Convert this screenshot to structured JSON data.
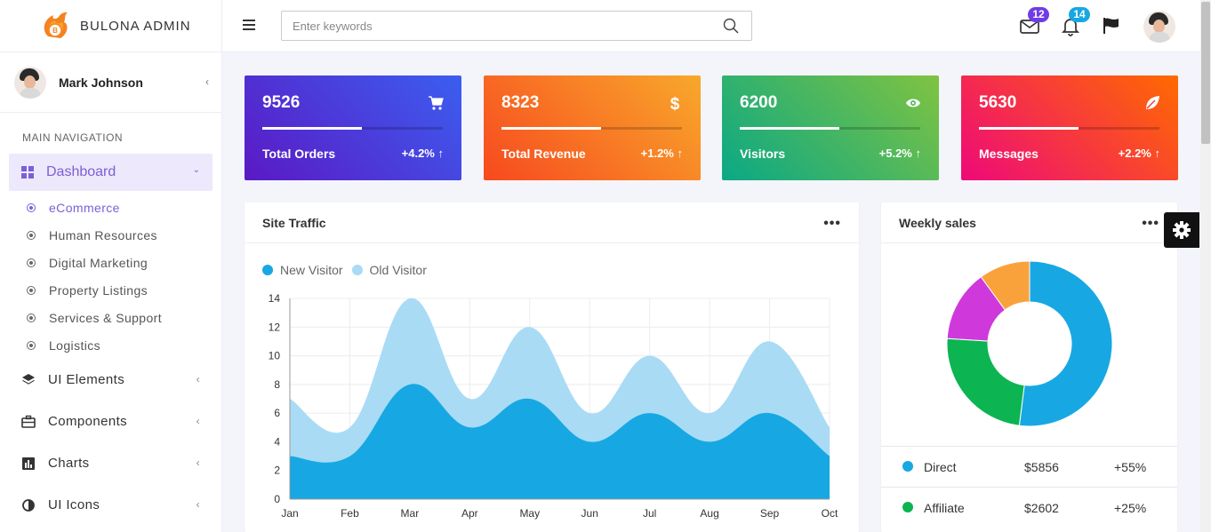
{
  "brand": {
    "name": "BULONA ADMIN"
  },
  "user": {
    "name": "Mark Johnson"
  },
  "nav": {
    "title": "MAIN NAVIGATION",
    "active": {
      "label": "Dashboard"
    },
    "sub_items": [
      {
        "label": "eCommerce",
        "active": true
      },
      {
        "label": "Human Resources"
      },
      {
        "label": "Digital Marketing"
      },
      {
        "label": "Property Listings"
      },
      {
        "label": "Services & Support"
      },
      {
        "label": "Logistics"
      }
    ],
    "items": [
      {
        "label": "UI Elements",
        "icon": "layers-icon"
      },
      {
        "label": "Components",
        "icon": "briefcase-icon"
      },
      {
        "label": "Charts",
        "icon": "bar-chart-icon"
      },
      {
        "label": "UI Icons",
        "icon": "contrast-icon"
      }
    ]
  },
  "topbar": {
    "search_placeholder": "Enter keywords",
    "mail_badge": "12",
    "bell_badge": "14",
    "mail_badge_color": "#6f3ce6",
    "bell_badge_color": "#17a8e3"
  },
  "stats": [
    {
      "value": "9526",
      "label": "Total Orders",
      "change": "+4.2%",
      "progress": 0.55,
      "icon": "cart-icon",
      "gradient": [
        "#5b19c4",
        "#3b5ef0"
      ]
    },
    {
      "value": "8323",
      "label": "Total Revenue",
      "change": "+1.2%",
      "progress": 0.55,
      "icon": "dollar-icon",
      "gradient": [
        "#f7491f",
        "#f8a82b"
      ]
    },
    {
      "value": "6200",
      "label": "Visitors",
      "change": "+5.2%",
      "progress": 0.55,
      "icon": "eye-icon",
      "gradient": [
        "#0aa885",
        "#80c341"
      ]
    },
    {
      "value": "5630",
      "label": "Messages",
      "change": "+2.2%",
      "progress": 0.55,
      "icon": "leaf-icon",
      "gradient": [
        "#ee0979",
        "#ff6a00"
      ]
    }
  ],
  "traffic": {
    "title": "Site Traffic",
    "legend": [
      "New Visitor",
      "Old Visitor"
    ]
  },
  "weekly": {
    "title": "Weekly sales",
    "rows": [
      {
        "name": "Direct",
        "amount": "$5856",
        "pct": "+55%",
        "color": "#17a8e3"
      },
      {
        "name": "Affiliate",
        "amount": "$2602",
        "pct": "+25%",
        "color": "#0cb452"
      }
    ]
  },
  "chart_data": [
    {
      "type": "area",
      "title": "Site Traffic",
      "categories": [
        "Jan",
        "Feb",
        "Mar",
        "Apr",
        "May",
        "Jun",
        "Jul",
        "Aug",
        "Sep",
        "Oct"
      ],
      "ylim": [
        0,
        14
      ],
      "yticks": [
        0,
        2,
        4,
        6,
        8,
        10,
        12,
        14
      ],
      "grid": true,
      "legend_position": "top-left",
      "series": [
        {
          "name": "Old Visitor",
          "color": "#a9dbf5",
          "values": [
            7,
            5,
            14,
            7,
            12,
            6,
            10,
            6,
            11,
            5
          ]
        },
        {
          "name": "New Visitor",
          "color": "#17a8e3",
          "values": [
            3,
            3,
            8,
            5,
            7,
            4,
            6,
            4,
            6,
            3
          ]
        }
      ]
    },
    {
      "type": "pie",
      "title": "Weekly sales",
      "donut": true,
      "slices": [
        {
          "value": 52,
          "color": "#17a8e3"
        },
        {
          "value": 24,
          "color": "#0cb452"
        },
        {
          "value": 14,
          "color": "#cf39dc"
        },
        {
          "value": 10,
          "color": "#f9a23c"
        }
      ]
    }
  ]
}
